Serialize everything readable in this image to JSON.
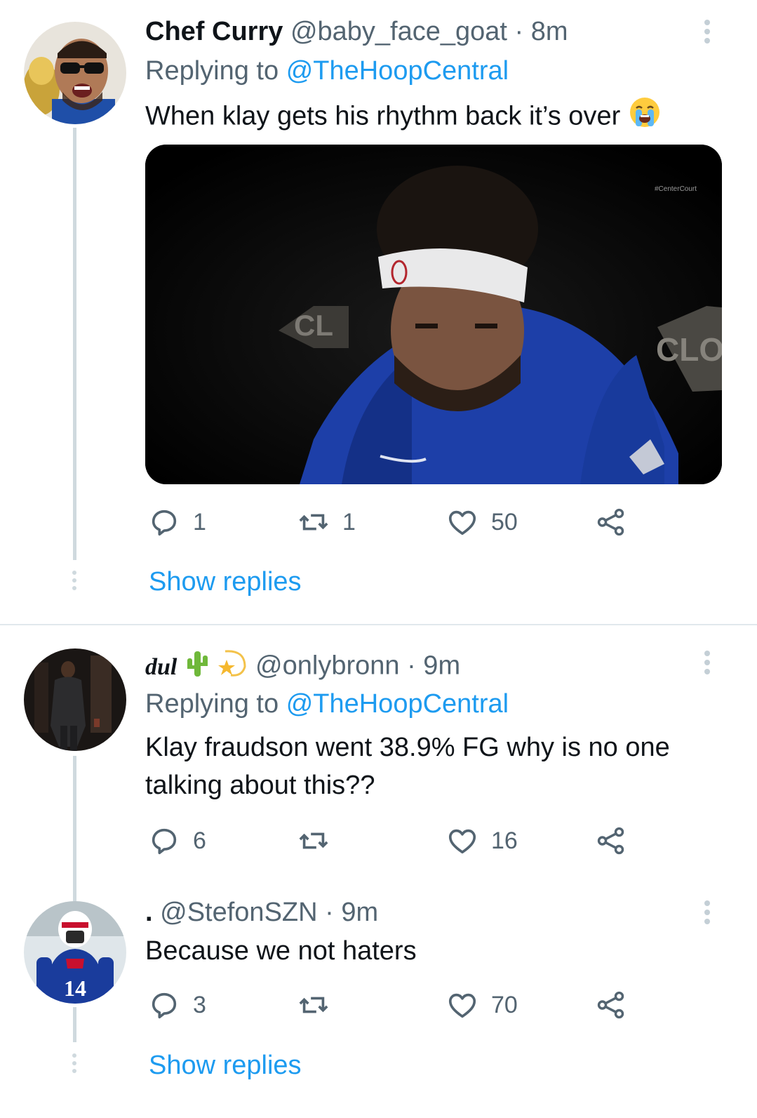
{
  "tweets": [
    {
      "display_name": "Chef Curry",
      "handle": "@baby_face_goat",
      "time": "· 8m",
      "replying_prefix": "Replying to",
      "replying_to": "@TheHoopCentral",
      "text": "When klay gets his rhythm back it’s over",
      "media_watermark": "#CenterCourt",
      "media_sign_left": "CL",
      "media_sign_right": "CLO",
      "reply_count": "1",
      "retweet_count": "1",
      "like_count": "50",
      "show_replies": "Show replies"
    },
    {
      "display_name": "dul",
      "handle": "@onlybronn",
      "time": "· 9m",
      "replying_prefix": "Replying to",
      "replying_to": "@TheHoopCentral",
      "text_line1": "Klay fraudson went 38.9% FG why is no one",
      "text_line2": "talking about this??",
      "reply_count": "6",
      "retweet_count": "",
      "like_count": "16"
    },
    {
      "display_name": ".",
      "handle": "@StefonSZN",
      "time": "· 9m",
      "text": "Because we not haters",
      "jersey_number": "14",
      "reply_count": "3",
      "retweet_count": "",
      "like_count": "70",
      "show_replies": "Show replies"
    }
  ],
  "colors": {
    "link": "#1d9bf0",
    "secondary_text": "#536471",
    "primary_text": "#0f1419",
    "thread_line": "#cfd9de"
  },
  "icons": [
    "reply-icon",
    "retweet-icon",
    "like-icon",
    "share-icon",
    "more-options-icon",
    "loudly-crying-face-emoji",
    "cactus-emoji",
    "shooting-star-emoji"
  ]
}
